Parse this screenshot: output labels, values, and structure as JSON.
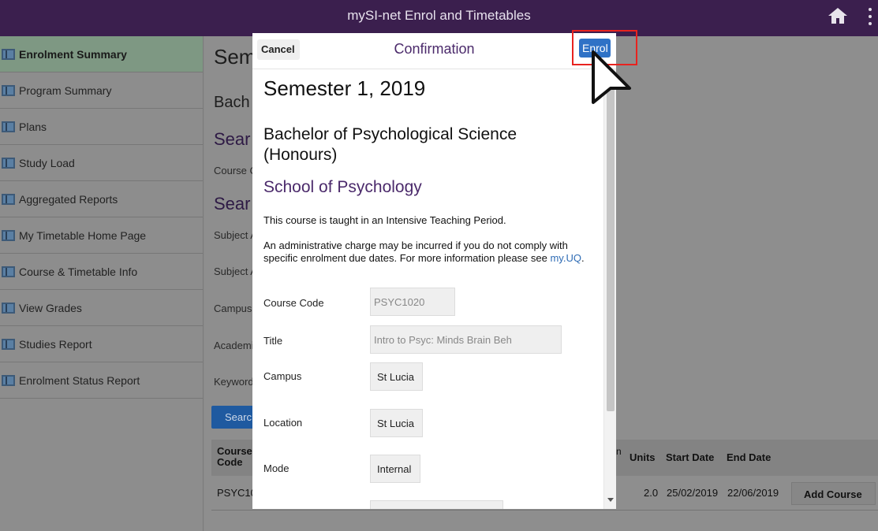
{
  "header": {
    "title": "mySI-net Enrol and Timetables"
  },
  "sidebar": {
    "items": [
      {
        "label": "Enrolment Summary",
        "active": true
      },
      {
        "label": "Program Summary"
      },
      {
        "label": "Plans"
      },
      {
        "label": "Study Load"
      },
      {
        "label": "Aggregated Reports"
      },
      {
        "label": "My Timetable Home Page"
      },
      {
        "label": "Course & Timetable Info"
      },
      {
        "label": "View Grades"
      },
      {
        "label": "Studies Report"
      },
      {
        "label": "Enrolment Status Report"
      }
    ]
  },
  "background": {
    "heading": "Sem",
    "subheading": "Bach",
    "search1": "Sear",
    "course_label": "Course C",
    "search2": "Sear",
    "field_labels": [
      "Subject A",
      "Subject A",
      "Campus",
      "Academi",
      "Keyword"
    ],
    "search_button": "Searc",
    "table": {
      "headers": {
        "code": "Course Code",
        "units": "Units",
        "start": "Start Date",
        "end": "End Date",
        "partial": "n"
      },
      "row": {
        "code": "PSYC10",
        "units": "2.0",
        "start": "25/02/2019",
        "end": "22/06/2019"
      },
      "add_button": "Add Course"
    }
  },
  "modal": {
    "cancel": "Cancel",
    "title": "Confirmation",
    "enrol": "Enrol",
    "semester": "Semester 1, 2019",
    "program": "Bachelor of Psychological Science (Honours)",
    "school": "School of Psychology",
    "info1": "This course is taught in an Intensive Teaching Period.",
    "info2": "An administrative charge may be incurred if you do not comply with specific enrolment due dates. For more information please see ",
    "info2_link": "my.UQ",
    "info2_end": ".",
    "fields": [
      {
        "label": "Course Code",
        "value": "PSYC1020"
      },
      {
        "label": "Title",
        "value": "Intro to Psyc: Minds Brain Beh"
      },
      {
        "label": "Campus",
        "value": "St Lucia"
      },
      {
        "label": "Location",
        "value": "St Lucia"
      },
      {
        "label": "Mode",
        "value": "Internal"
      }
    ]
  },
  "colors": {
    "header": "#3b1f4e",
    "accent_purple": "#4b2a6b",
    "enrol_blue": "#2f72c6",
    "highlight_red": "#e8231f"
  },
  "icons": {
    "home": "home-icon",
    "more": "more-vertical-icon",
    "sidebar": "table-icon",
    "cursor": "cursor-arrow-icon"
  }
}
